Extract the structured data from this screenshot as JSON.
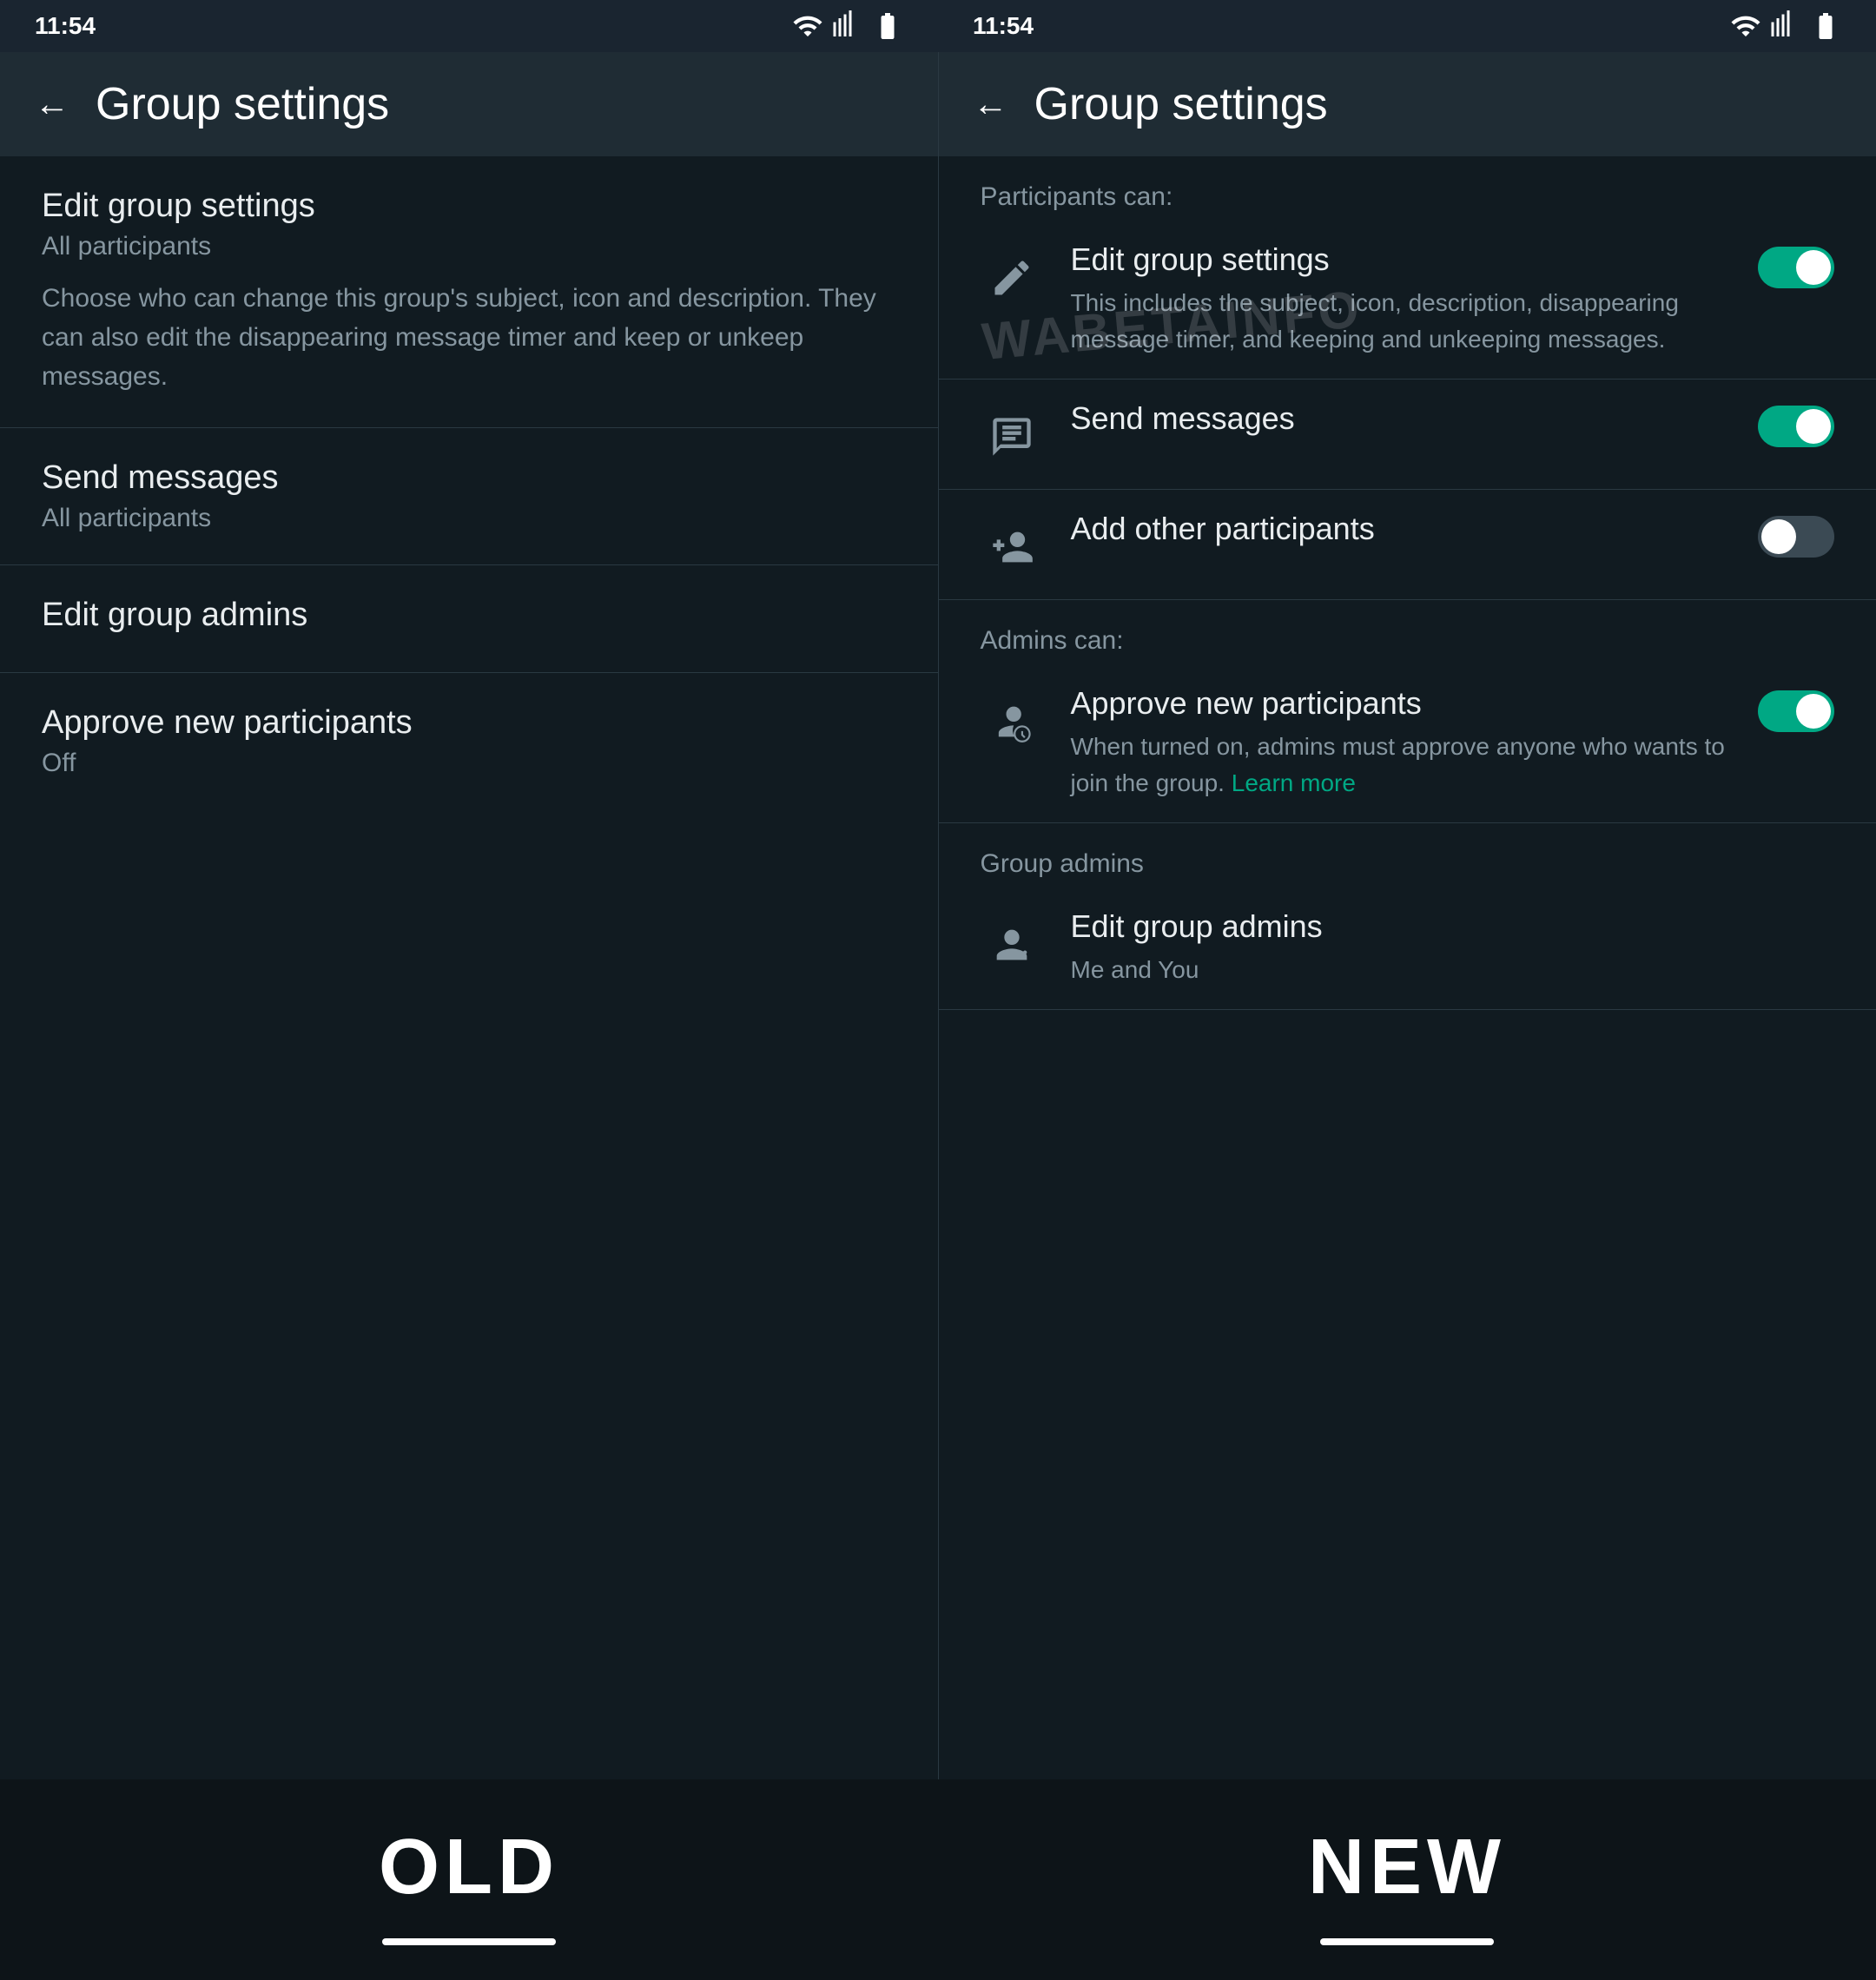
{
  "left_panel": {
    "status_time": "11:54",
    "header_title": "Group settings",
    "back_label": "←",
    "items": [
      {
        "title": "Edit group settings",
        "subtitle": "All participants",
        "desc": "Choose who can change this group's subject, icon and description. They can also edit the disappearing message timer and keep or unkeep messages."
      },
      {
        "title": "Send messages",
        "subtitle": "All participants",
        "desc": ""
      },
      {
        "title": "Edit group admins",
        "subtitle": "",
        "desc": ""
      },
      {
        "title": "Approve new participants",
        "subtitle": "Off",
        "desc": ""
      }
    ],
    "bottom_label": "OLD"
  },
  "right_panel": {
    "status_time": "11:54",
    "header_title": "Group settings",
    "back_label": "←",
    "section1_label": "Participants can:",
    "participants_items": [
      {
        "id": "edit-group-settings",
        "title": "Edit group settings",
        "desc": "This includes the subject, icon, description, disappearing message timer, and keeping and unkeeping messages.",
        "toggle": "on",
        "icon": "pencil"
      },
      {
        "id": "send-messages",
        "title": "Send messages",
        "desc": "",
        "toggle": "on",
        "icon": "message"
      },
      {
        "id": "add-other-participants",
        "title": "Add other participants",
        "desc": "",
        "toggle": "off",
        "icon": "add-person"
      }
    ],
    "section2_label": "Admins can:",
    "admins_items": [
      {
        "id": "approve-new-participants",
        "title": "Approve new participants",
        "desc_part1": "When turned on, admins must approve anyone who wants to join the group.",
        "learn_more": "Learn more",
        "toggle": "on",
        "icon": "person-clock"
      }
    ],
    "section3_label": "Group admins",
    "group_admin_items": [
      {
        "id": "edit-group-admins",
        "title": "Edit group admins",
        "subtitle": "Me and You",
        "icon": "person-gear"
      }
    ],
    "bottom_label": "NEW",
    "watermark": "WABETAINFO"
  }
}
